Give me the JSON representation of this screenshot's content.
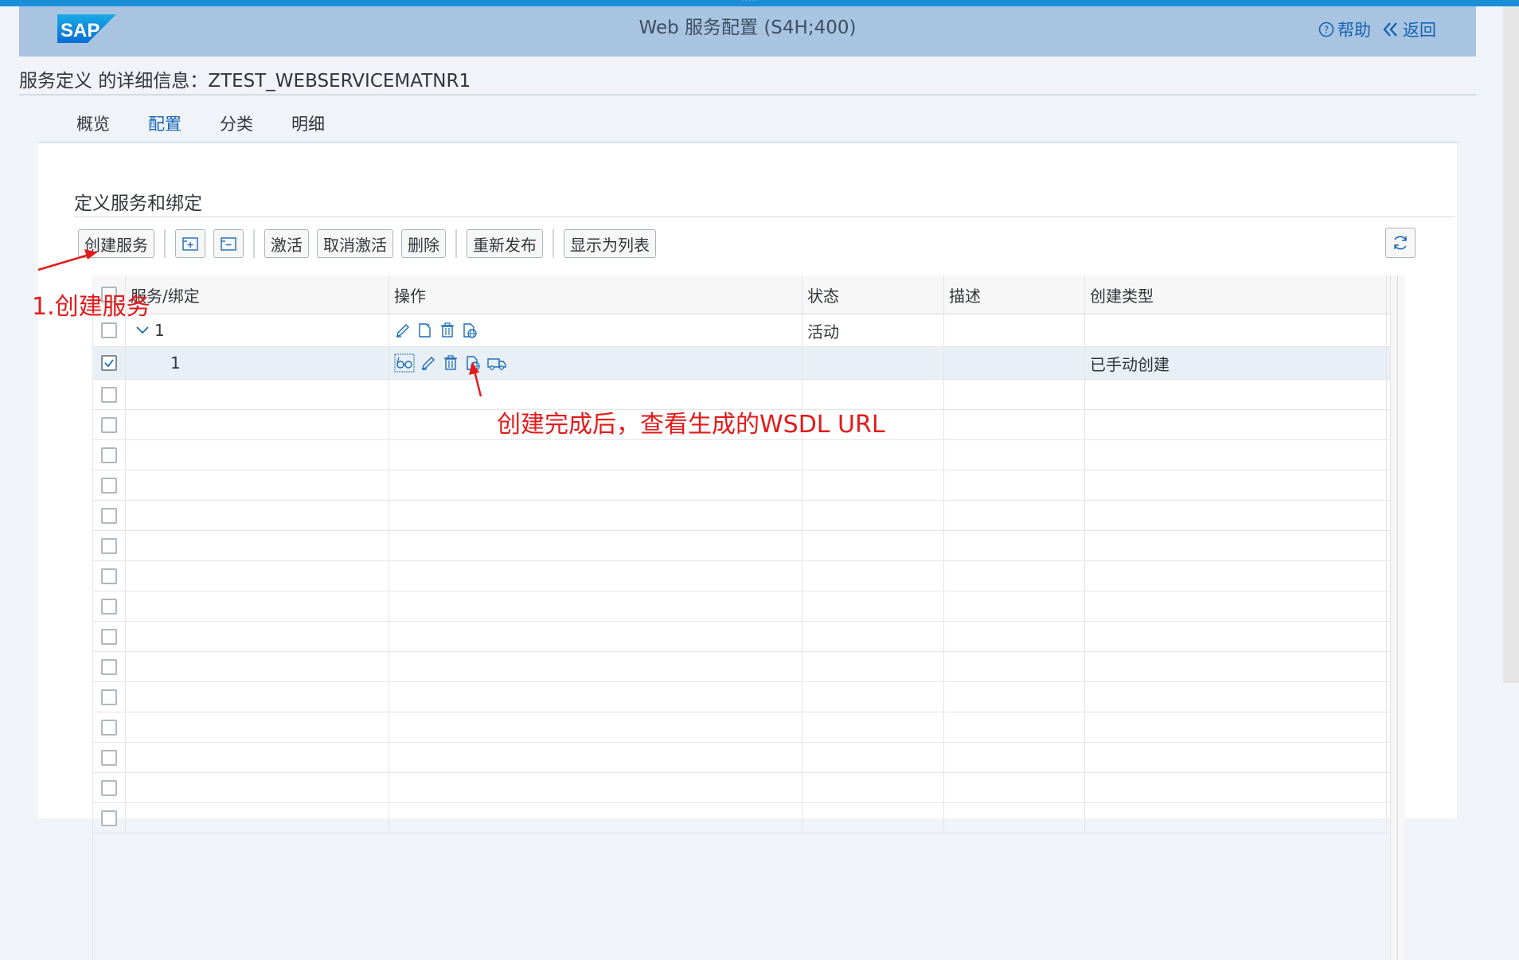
{
  "shell": {
    "logo_text": "SAP",
    "title": "Web 服务配置 (S4H;400)",
    "help_label": "帮助",
    "back_label": "返回"
  },
  "page_header": "服务定义 的详细信息：ZTEST_WEBSERVICEMATNR1",
  "tabs": [
    {
      "label": "概览"
    },
    {
      "label": "配置",
      "active": true
    },
    {
      "label": "分类"
    },
    {
      "label": "明细"
    }
  ],
  "section": {
    "title": "定义服务和绑定",
    "toolbar": {
      "create_service": "创建服务",
      "activate": "激活",
      "deactivate": "取消激活",
      "delete": "删除",
      "republish": "重新发布",
      "show_as_list": "显示为列表"
    }
  },
  "table": {
    "columns": [
      "服务/绑定",
      "操作",
      "状态",
      "描述",
      "创建类型"
    ],
    "rows": [
      {
        "name": "1",
        "status": "活动",
        "description": "",
        "creation_type": ""
      },
      {
        "name": "1",
        "status": "",
        "description": "",
        "creation_type": "已手动创建"
      }
    ]
  },
  "annotations": {
    "step1": "1.创建服务",
    "step2": "创建完成后，查看生成的WSDL URL",
    "color": "#e21b1b"
  },
  "colors": {
    "shellbar": "#a9c4e1",
    "accent": "#1464b4",
    "topstrip": "#1a8fd8"
  }
}
